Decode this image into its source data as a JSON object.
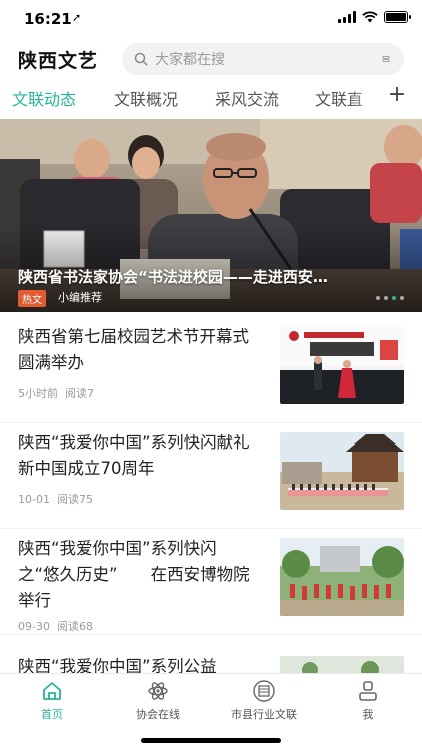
{
  "status_bar": {
    "time": "16:21",
    "location_glyph": "➚"
  },
  "header": {
    "title": "陕西文艺",
    "search_placeholder": "大家都在搜"
  },
  "tabs": [
    {
      "label": "文联动态",
      "active": true
    },
    {
      "label": "文联概况",
      "active": false
    },
    {
      "label": "采风交流",
      "active": false
    },
    {
      "label": "文联直",
      "active": false
    }
  ],
  "tabs_more_label": "+",
  "banner": {
    "caption": "陕西省书法家协会“书法进校园——走进西安…",
    "badge": "热文",
    "source": "小编推荐",
    "dots": 4,
    "active_dot": 3
  },
  "news": [
    {
      "title": "陕西省第七届校园艺术节开幕式圆满举办",
      "time": "5小时前",
      "reads": "阅读7"
    },
    {
      "title": "陕西“我爱你中国”系列快闪献礼新中国成立70周年",
      "time": "10-01",
      "reads": "阅读75"
    },
    {
      "title": "陕西“我爱你中国”系列快闪之“悠久历史”　　在西安博物院举行",
      "time": "09-30",
      "reads": "阅读68"
    },
    {
      "title": "陕西“我爱你中国”系列公益",
      "time": "",
      "reads": ""
    }
  ],
  "bottom_nav": [
    {
      "label": "首页",
      "icon": "home-icon",
      "active": true
    },
    {
      "label": "协会在线",
      "icon": "atom-icon",
      "active": false
    },
    {
      "label": "市县行业文联",
      "icon": "building-icon",
      "active": false
    },
    {
      "label": "我",
      "icon": "user-icon",
      "active": false
    }
  ],
  "colors": {
    "accent": "#27b49a",
    "badge": "#e15b35"
  }
}
